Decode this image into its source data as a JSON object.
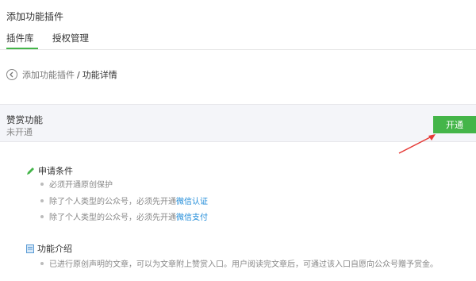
{
  "header": {
    "title": "添加功能插件"
  },
  "tabs": [
    {
      "label": "插件库",
      "active": true
    },
    {
      "label": "授权管理",
      "active": false
    }
  ],
  "breadcrumb": {
    "parent": "添加功能插件",
    "separator": "/",
    "current": "功能详情"
  },
  "feature": {
    "name": "赞赏功能",
    "status": "未开通",
    "open_button": "开通"
  },
  "conditions": {
    "title": "申请条件",
    "items": [
      {
        "text": "必须开通原创保护",
        "link": ""
      },
      {
        "text": "除了个人类型的公众号，必须先开通",
        "link": "微信认证"
      },
      {
        "text": "除了个人类型的公众号，必须先开通",
        "link": "微信支付"
      }
    ]
  },
  "intro": {
    "title": "功能介绍",
    "text": "已进行原创声明的文章，可以为文章附上赞赏入口。用户阅读完文章后，可通过该入口自愿向公众号赠予赏金。"
  },
  "colors": {
    "accent": "#44b549",
    "link": "#1d8ad8",
    "annotation_arrow": "#e53935"
  }
}
